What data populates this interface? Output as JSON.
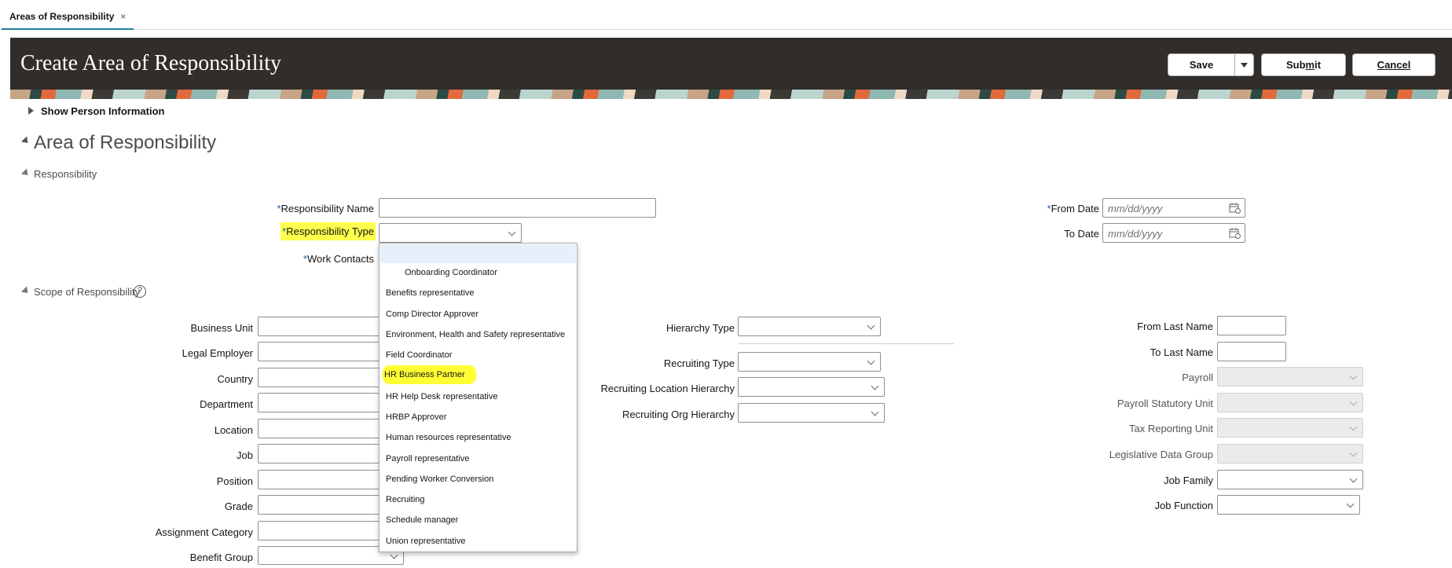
{
  "tab": {
    "label": "Areas of Responsibility",
    "close": "×"
  },
  "header": {
    "title": "Create Area of Responsibility",
    "save": "Save",
    "submit_pre": "Sub",
    "submit_ul": "m",
    "submit_post": "it",
    "cancel_ul": "C",
    "cancel_post": "ancel"
  },
  "show_person_info": "Show Person Information",
  "section_title": "Area of Responsibility",
  "responsibility": {
    "heading": "Responsibility",
    "name_label": "Responsibility Name",
    "type_label": "Responsibility Type",
    "contacts_label": "Work Contacts",
    "from_date_label": "From Date",
    "to_date_label": "To Date",
    "date_placeholder": "mm/dd/yyyy",
    "required_mark": "*"
  },
  "dropdown_options": [
    "Onboarding Coordinator",
    "Benefits representative",
    "Comp Director Approver",
    "Environment, Health and Safety representative",
    "Field Coordinator",
    "HR Business Partner",
    "HR Help Desk representative",
    "HRBP Approver",
    "Human resources representative",
    "Payroll representative",
    "Pending Worker Conversion",
    "Recruiting",
    "Schedule manager",
    "Union representative"
  ],
  "scope": {
    "heading": "Scope of Responsibility",
    "help": "?",
    "left_labels": [
      "Business Unit",
      "Legal Employer",
      "Country",
      "Department",
      "Location",
      "Job",
      "Position",
      "Grade",
      "Assignment Category",
      "Benefit Group"
    ],
    "mid_labels": [
      "Hierarchy Type",
      "Recruiting Type",
      "Recruiting Location Hierarchy",
      "Recruiting Org Hierarchy"
    ],
    "right_labels": [
      "From Last Name",
      "To Last Name",
      "Payroll",
      "Payroll Statutory Unit",
      "Tax Reporting Unit",
      "Legislative Data Group",
      "Job Family",
      "Job Function"
    ]
  },
  "colors": {
    "banner": "#312d2a",
    "highlight": "#ffff4d",
    "required": "#1a5c99"
  }
}
